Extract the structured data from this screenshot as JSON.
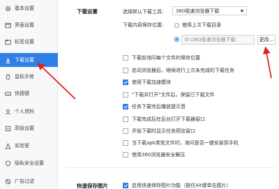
{
  "sidebar": {
    "items": [
      {
        "label": "基本设置",
        "icon": "gear-icon"
      },
      {
        "label": "界面设置",
        "icon": "layout-icon"
      },
      {
        "label": "标签设置",
        "icon": "tab-icon"
      },
      {
        "label": "下载设置",
        "icon": "download-icon",
        "active": true
      },
      {
        "label": "鼠标手势",
        "icon": "mouse-icon"
      },
      {
        "label": "快捷键",
        "icon": "keyboard-icon"
      },
      {
        "label": "个人资料",
        "icon": "person-icon"
      },
      {
        "label": "高级设置",
        "icon": "advanced-icon"
      },
      {
        "label": "实验室",
        "icon": "lab-icon"
      },
      {
        "label": "隐私安全设置",
        "icon": "shield-icon"
      },
      {
        "label": "广告过滤",
        "icon": "block-icon"
      }
    ]
  },
  "download": {
    "section_title": "下载设置",
    "tool_label": "选择默认下载工具:",
    "tool_value": "360极速浏览器下载",
    "location_label": "下载内容保存位置:",
    "last_dir_label": "使用上次下载目录",
    "path_value": "D:\\360极速浏览器下载",
    "change_button": "更改...",
    "options": [
      {
        "label": "下载前询问每个文件的保存位置",
        "checked": false
      },
      {
        "label": "启动浏览器后，继续进行上次未完成的下载任务",
        "checked": false
      },
      {
        "label": "使用下载加速模块",
        "checked": true
      },
      {
        "label": "\"下载并打开\"文件后，保留已下载文件",
        "checked": false
      },
      {
        "label": "任务下载完后播放提示音",
        "checked": true
      },
      {
        "label": "下载完成后在后台打开下载器窗口",
        "checked": false
      },
      {
        "label": "开始下载时显示任务预览窗口",
        "checked": false
      },
      {
        "label": "当下载apk类型文件时，询问是否一键安装到手机",
        "checked": false
      },
      {
        "label": "使用360浏览器安全解压",
        "checked": false
      }
    ]
  },
  "quicksave": {
    "section_title": "快速保存图片",
    "option_label": "启用快速保存图片功能（按住Alt键单击图片）",
    "checked": true
  },
  "colors": {
    "accent": "#2f7fe6",
    "annotation": "#e02020"
  }
}
